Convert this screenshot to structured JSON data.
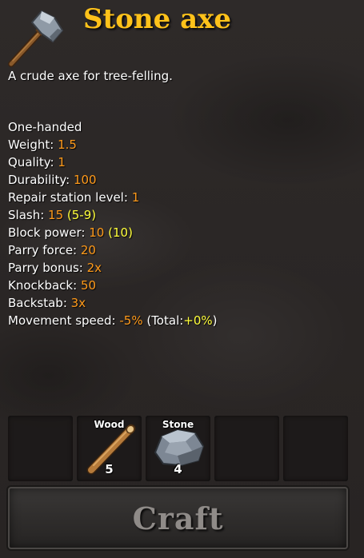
{
  "item": {
    "title": "Stone axe",
    "description": "A crude axe for tree-felling.",
    "icon": "stone-axe-icon"
  },
  "stats": {
    "handedness": "One-handed",
    "weight": {
      "label": "Weight: ",
      "value": "1.5"
    },
    "quality": {
      "label": "Quality: ",
      "value": "1"
    },
    "durability": {
      "label": "Durability: ",
      "value": "100"
    },
    "repair_station_level": {
      "label": "Repair station level: ",
      "value": "1"
    },
    "slash": {
      "label": "Slash: ",
      "value": "15",
      "range": "(5-9)"
    },
    "block_power": {
      "label": "Block power: ",
      "value": "10",
      "extra": "(10)"
    },
    "parry_force": {
      "label": "Parry force: ",
      "value": "20"
    },
    "parry_bonus": {
      "label": "Parry bonus: ",
      "value": "2x"
    },
    "knockback": {
      "label": "Knockback: ",
      "value": "50"
    },
    "backstab": {
      "label": "Backstab: ",
      "value": "3x"
    },
    "movement_speed": {
      "label": "Movement speed: ",
      "value": "-5%",
      "total_prefix": " (Total:",
      "total_value": "+0%",
      "total_suffix": ")"
    }
  },
  "requirements": [
    {
      "name": "",
      "amount": "",
      "icon": ""
    },
    {
      "name": "Wood",
      "amount": "5",
      "icon": "wood-icon"
    },
    {
      "name": "Stone",
      "amount": "4",
      "icon": "stone-icon"
    },
    {
      "name": "",
      "amount": "",
      "icon": ""
    },
    {
      "name": "",
      "amount": "",
      "icon": ""
    }
  ],
  "craft_button": {
    "label": "Craft"
  },
  "colors": {
    "title": "#ffc21a",
    "value": "#ff9a1a",
    "highlight": "#ffff3a",
    "text": "#ffffff",
    "button_text": "#8f8b88"
  }
}
